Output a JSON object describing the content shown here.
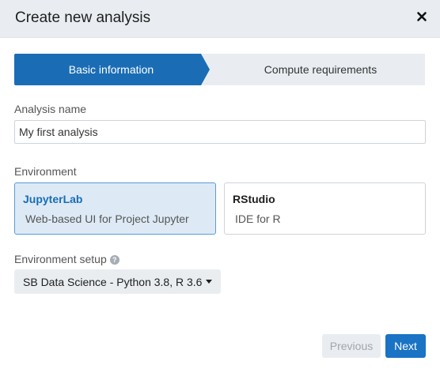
{
  "modal": {
    "title": "Create new analysis"
  },
  "steps": [
    {
      "label": "Basic information",
      "active": true
    },
    {
      "label": "Compute requirements",
      "active": false
    }
  ],
  "analysis_name": {
    "label": "Analysis name",
    "value": "My first analysis"
  },
  "environment": {
    "label": "Environment",
    "options": [
      {
        "title": "JupyterLab",
        "description": "Web-based UI for Project Jupyter",
        "selected": true
      },
      {
        "title": "RStudio",
        "description": "IDE for R",
        "selected": false
      }
    ]
  },
  "environment_setup": {
    "label": "Environment setup",
    "help_icon": "?",
    "selected": "SB Data Science - Python 3.8, R 3.6"
  },
  "footer": {
    "previous_label": "Previous",
    "next_label": "Next"
  },
  "colors": {
    "primary": "#1a73c4",
    "header_bg": "#e9edf1",
    "selected_card_bg": "#ddeaf6"
  }
}
